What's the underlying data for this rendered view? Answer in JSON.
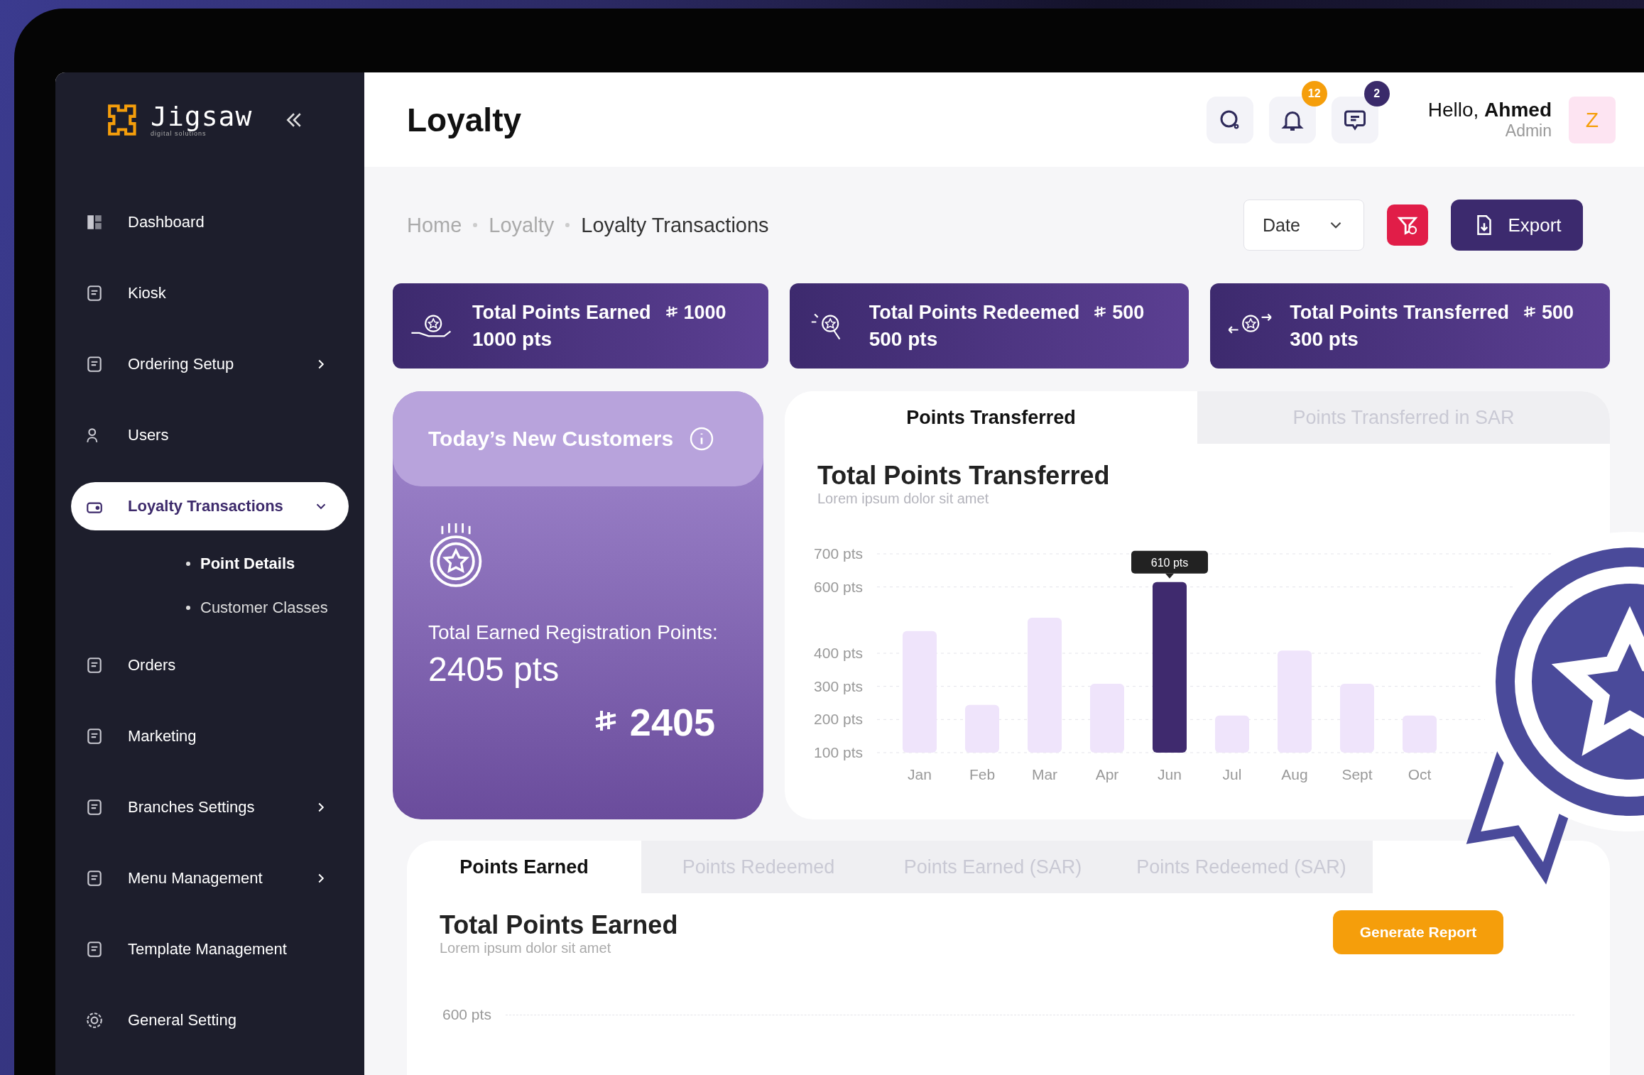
{
  "brand": {
    "name": "Jigsaw",
    "tagline": "digital solutions"
  },
  "sidebar": {
    "items": [
      {
        "label": "Dashboard",
        "kind": "dashboard",
        "selected": false
      },
      {
        "label": "Kiosk",
        "kind": "kiosk",
        "selected": false
      },
      {
        "label": "Ordering Setup",
        "kind": "ordering",
        "selected": false,
        "expanded": false
      },
      {
        "label": "Users",
        "kind": "users",
        "selected": false
      },
      {
        "label": "Loyalty Transactions",
        "kind": "loyalty",
        "selected": true,
        "expanded": true,
        "children": [
          {
            "label": "Point Details",
            "selected": true
          },
          {
            "label": "Customer Classes",
            "selected": false
          }
        ]
      },
      {
        "label": "Orders",
        "kind": "orders",
        "selected": false
      },
      {
        "label": "Marketing",
        "kind": "marketing",
        "selected": false
      },
      {
        "label": "Branches Settings",
        "kind": "branches",
        "selected": false,
        "expanded": false
      },
      {
        "label": "Menu Management",
        "kind": "menu",
        "selected": false,
        "expanded": false
      },
      {
        "label": "Template Management",
        "kind": "template",
        "selected": false
      },
      {
        "label": "General Setting",
        "kind": "settings",
        "selected": false
      }
    ]
  },
  "header": {
    "title": "Loyalty",
    "notifications_count": "12",
    "messages_count": "2",
    "greeting": "Hello, **Ahmed**",
    "role": "Admin",
    "avatar_letter": "Z"
  },
  "breadcrumb": [
    "Home",
    "Loyalty",
    "Loyalty Transactions"
  ],
  "toolbar": {
    "date_filter": "Date",
    "export_label": "Export"
  },
  "stats": [
    {
      "kind": "earned",
      "title": "Total Points Earned",
      "amount": "1000",
      "points": "1000 pts"
    },
    {
      "kind": "redeemed",
      "title": "Total Points Redeemed",
      "amount": "500",
      "points": "500 pts"
    },
    {
      "kind": "transferred",
      "title": "Total Points Transferred",
      "amount": "500",
      "points": "300 pts"
    }
  ],
  "customers_card": {
    "title": "Today’s New Customers",
    "label": "Total Earned Registration Points:",
    "points": "2405 pts",
    "amount": "2405"
  },
  "transfer_panel": {
    "tabs": [
      {
        "label": "Points Transferred",
        "selected": true
      },
      {
        "label": "Points Transferred in SAR",
        "selected": false
      }
    ],
    "title": "Total Points Transferred",
    "subtitle": "Lorem ipsum dolor sit amet",
    "chart_data": {
      "type": "bar",
      "categories": [
        "Jan",
        "Feb",
        "Mar",
        "Apr",
        "Jun",
        "Jul",
        "Aug",
        "Sept",
        "Oct"
      ],
      "values": [
        467,
        244,
        507,
        308,
        615,
        212,
        408,
        308,
        212
      ],
      "ylim": [
        100,
        700
      ],
      "yticks": [
        {
          "value": 100,
          "label": "100 pts"
        },
        {
          "value": 200,
          "label": "200 pts"
        },
        {
          "value": 300,
          "label": "300 pts"
        },
        {
          "value": 400,
          "label": "400 pts"
        },
        {
          "value": 600,
          "label": "600 pts"
        },
        {
          "value": 700,
          "label": "700 pts"
        }
      ],
      "grid": true,
      "annotations": [
        "610 pts"
      ]
    }
  },
  "earned_panel": {
    "tabs": [
      {
        "label": "Points Earned",
        "selected": true
      },
      {
        "label": "Points Redeemed",
        "selected": false
      },
      {
        "label": "Points Earned (SAR)",
        "selected": false
      },
      {
        "label": "Points Redeemed (SAR)",
        "selected": false
      }
    ],
    "title": "Total Points Earned",
    "subtitle": "Lorem ipsum dolor sit amet",
    "report_button": "Generate Report",
    "axis_label": "600 pts"
  }
}
